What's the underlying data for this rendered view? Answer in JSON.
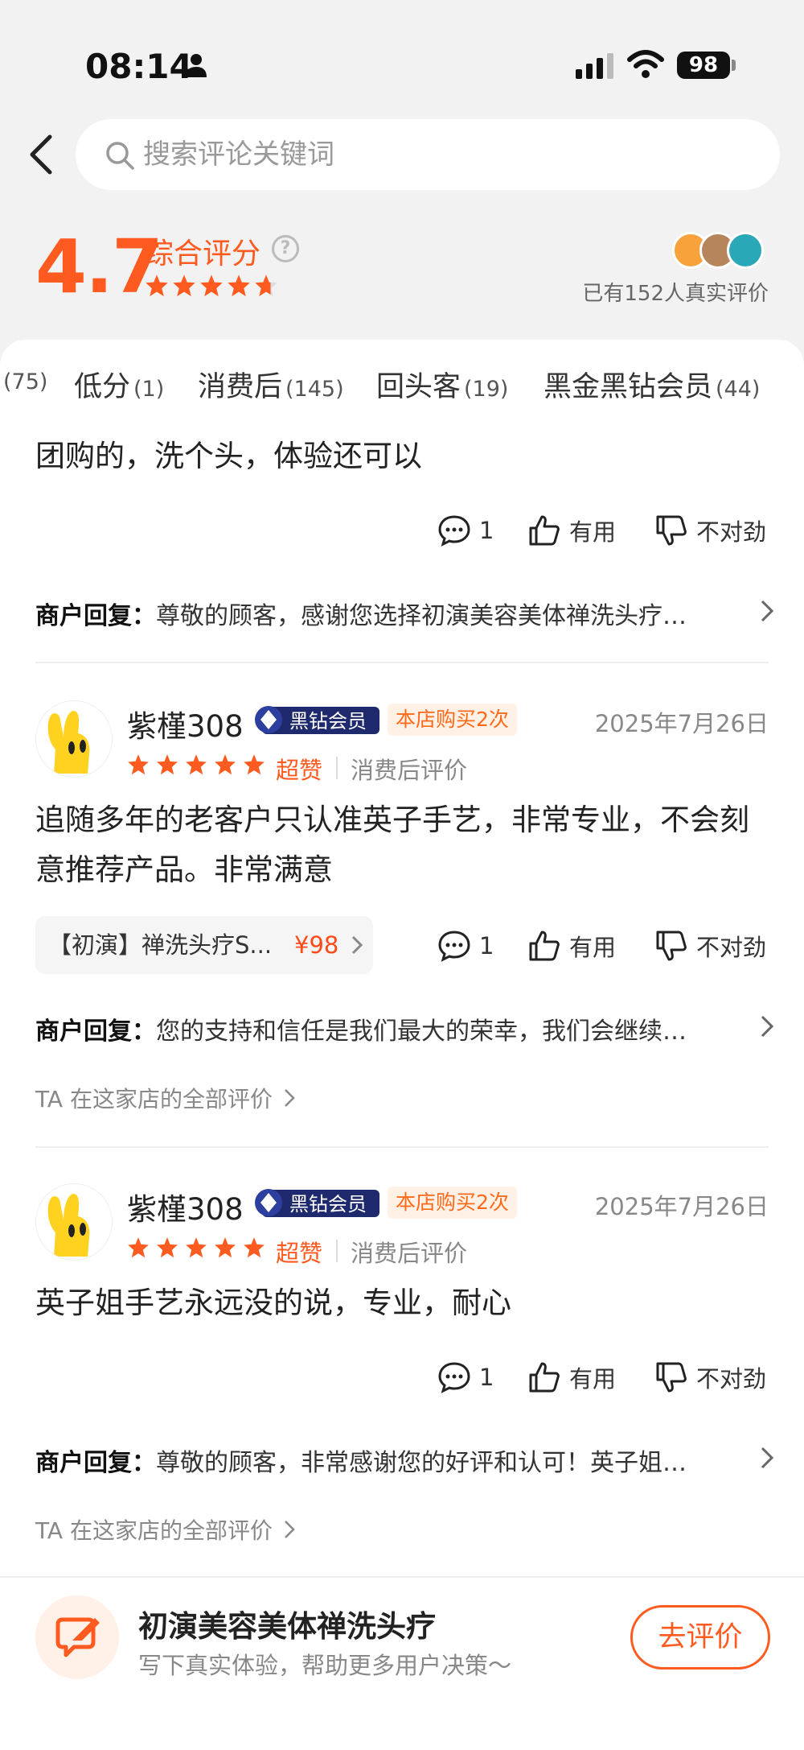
{
  "status_bar": {
    "time": "08:14",
    "battery": "98"
  },
  "search": {
    "placeholder": "搜索评论关键词"
  },
  "rating": {
    "score": "4.7",
    "label": "综合评分",
    "help": "?",
    "reviewers_text": "已有152人真实评价",
    "star_value": 4.7
  },
  "tabs": [
    {
      "label": "",
      "count": "(75)"
    },
    {
      "label": "低分",
      "count": "(1)"
    },
    {
      "label": "消费后",
      "count": "(145)"
    },
    {
      "label": "回头客",
      "count": "(19)"
    },
    {
      "label": "黑金黑钻会员",
      "count": "(44)"
    }
  ],
  "actions": {
    "comment_count": "1",
    "useful": "有用",
    "wrong": "不对劲"
  },
  "review0": {
    "text": "团购的，洗个头，体验还可以",
    "reply_label": "商户回复：",
    "reply_text": "尊敬的顾客，感谢您选择初演美容美体禅洗头疗…"
  },
  "review1": {
    "user": "紫槿308",
    "vip": "黑钻会员",
    "buy_badge": "本店购买2次",
    "date": "2025年7月26日",
    "rating_word": "超赞",
    "review_type": "消费后评价",
    "stars": 5,
    "text": "追随多年的老客户只认准英子手艺，非常专业，不会刻意推荐产品。非常满意",
    "product_name": "【初演】禅洗头疗S...",
    "product_price": "¥98",
    "reply_label": "商户回复：",
    "reply_text": "您的支持和信任是我们最大的荣幸，我们会继续…",
    "all_reviews": "TA 在这家店的全部评价"
  },
  "review2": {
    "user": "紫槿308",
    "vip": "黑钻会员",
    "buy_badge": "本店购买2次",
    "date": "2025年7月26日",
    "rating_word": "超赞",
    "review_type": "消费后评价",
    "stars": 5,
    "text": "英子姐手艺永远没的说，专业，耐心",
    "reply_label": "商户回复：",
    "reply_text": "尊敬的顾客，非常感谢您的好评和认可！英子姐…",
    "all_reviews": "TA 在这家店的全部评价"
  },
  "bottom_bar": {
    "title": "初演美容美体禅洗头疗",
    "subtitle": "写下真实体验，帮助更多用户决策～",
    "button": "去评价"
  },
  "colors": {
    "accent": "#ff5a1f",
    "vip_bg": "#1f2a6e"
  }
}
